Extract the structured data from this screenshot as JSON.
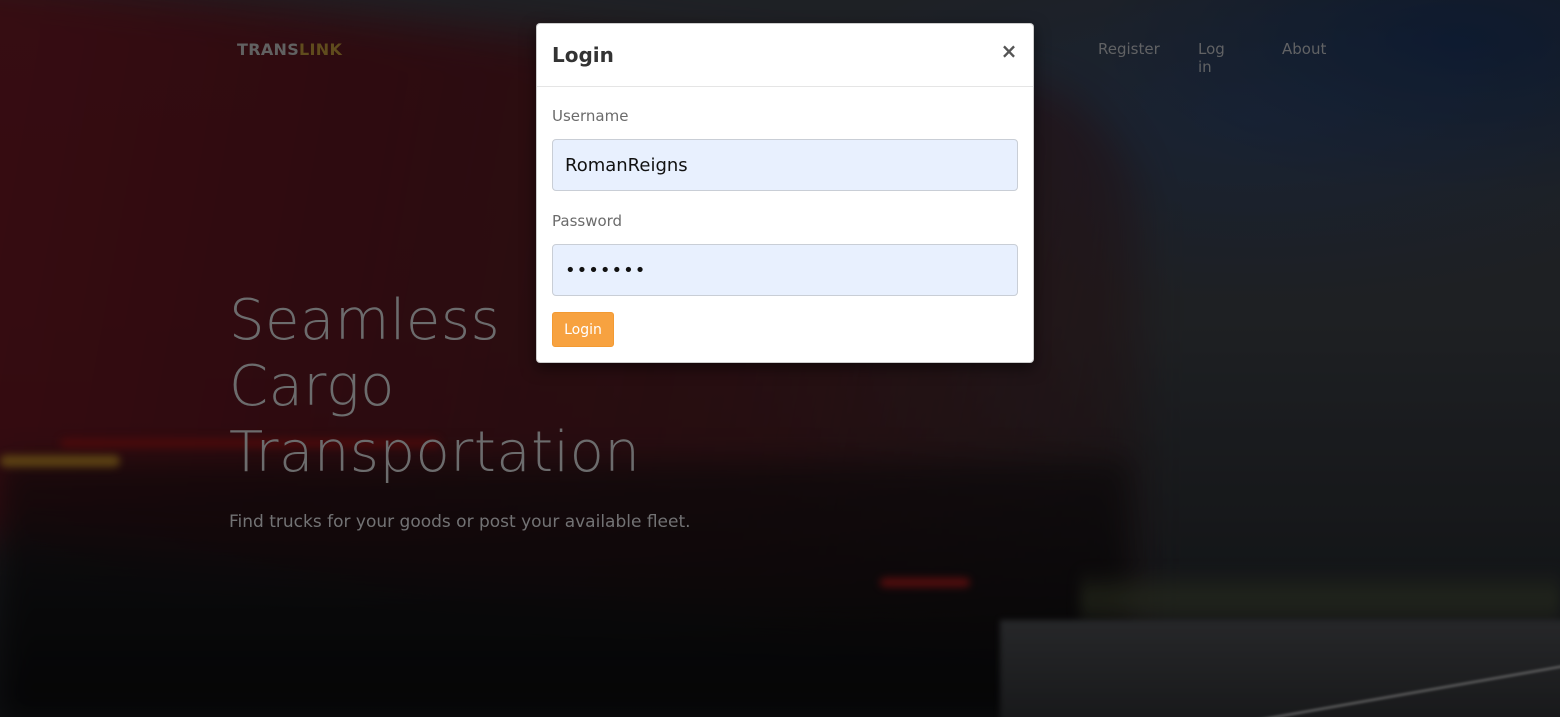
{
  "navbar": {
    "brand_part1": "TRANS",
    "brand_part2": "LINK",
    "links": [
      "Register",
      "Log in",
      "About"
    ]
  },
  "hero": {
    "headline_lines": [
      "Seamless",
      "Cargo",
      "Transportation"
    ],
    "tagline": "Find trucks for your goods or post your available fleet."
  },
  "modal": {
    "title": "Login",
    "close_icon": "×",
    "username_label": "Username",
    "username_value": "RomanReigns",
    "password_label": "Password",
    "password_value": "•••••••",
    "submit_label": "Login"
  },
  "colors": {
    "accent": "#f7a240",
    "brand_link": "#8a6d2a",
    "input_bg": "#e8f0fe"
  }
}
